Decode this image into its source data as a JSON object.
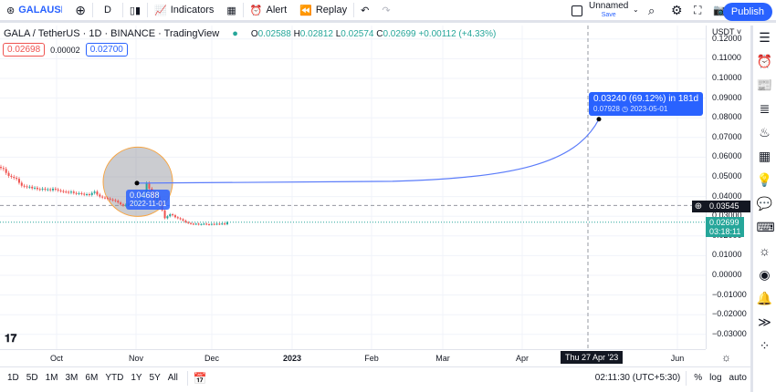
{
  "toolbar": {
    "symbol": "GALAUSDT",
    "interval": "D",
    "indicators": "Indicators",
    "alert": "Alert",
    "replay": "Replay",
    "layout_name": "Unnamed",
    "save": "Save",
    "publish": "Publish"
  },
  "legend": {
    "title": "GALA / TetherUS · 1D · BINANCE · TradingView",
    "o_label": "O",
    "o": "0.02588",
    "h_label": "H",
    "h": "0.02812",
    "l_label": "L",
    "l": "0.02574",
    "c_label": "C",
    "c": "0.02699",
    "change": "+0.00112 (+4.33%)",
    "bid": "0.02698",
    "spread": "0.00002",
    "ask": "0.02700"
  },
  "axis": {
    "currency": "USDT",
    "price_labels": [
      "0.12000",
      "0.11000",
      "0.10000",
      "0.09000",
      "0.08000",
      "0.07000",
      "0.06000",
      "0.05000",
      "0.04000",
      "0.03000",
      "0.02000",
      "0.01000",
      "0.00000",
      "−0.01000",
      "−0.02000",
      "−0.03000"
    ],
    "crosshair_price": "0.03545",
    "last_price": "0.02699",
    "countdown": "03:18:11"
  },
  "time_axis": {
    "labels": [
      "Oct",
      "Nov",
      "Dec",
      "2023",
      "Feb",
      "Mar",
      "Apr",
      "Jun"
    ],
    "crosshair_date": "Thu 27 Apr '23"
  },
  "projection": {
    "start_price": "0.04688",
    "start_date": "2022-11-01",
    "label": "0.03240 (69.12%) in 181d",
    "target": "0.07928",
    "target_date": "2023-05-01"
  },
  "bottom": {
    "ranges": [
      "1D",
      "5D",
      "1M",
      "3M",
      "6M",
      "YTD",
      "1Y",
      "5Y",
      "All"
    ],
    "clock": "02:11:30 (UTC+5:30)",
    "percent": "%",
    "log": "log",
    "auto": "auto"
  },
  "colors": {
    "up": "#26a69a",
    "down": "#ef5350",
    "accent": "#2962ff"
  },
  "chart_data": {
    "type": "candlestick",
    "start_date": "2022-09-05",
    "closes": [
      0.0545,
      0.054,
      0.052,
      0.0505,
      0.05,
      0.0495,
      0.049,
      0.047,
      0.0455,
      0.0452,
      0.0448,
      0.045,
      0.0442,
      0.0445,
      0.0438,
      0.0436,
      0.044,
      0.0435,
      0.0437,
      0.0432,
      0.044,
      0.0436,
      0.0431,
      0.0428,
      0.0425,
      0.0424,
      0.042,
      0.0425,
      0.0418,
      0.0415,
      0.0417,
      0.0414,
      0.041,
      0.0412,
      0.0408,
      0.0418,
      0.0425,
      0.041,
      0.04,
      0.0395,
      0.0393,
      0.039,
      0.0385,
      0.0382,
      0.0378,
      0.037,
      0.036,
      0.0355,
      0.0358,
      0.0362,
      0.036,
      0.0365,
      0.037,
      0.038,
      0.0395,
      0.042,
      0.0468,
      0.044,
      0.042,
      0.038,
      0.04,
      0.037,
      0.033,
      0.029,
      0.03,
      0.031,
      0.0305,
      0.0295,
      0.029,
      0.0285,
      0.0278,
      0.027,
      0.0265,
      0.0262,
      0.026,
      0.0262,
      0.0258,
      0.026,
      0.0262,
      0.0259,
      0.0258,
      0.0261,
      0.0259,
      0.0262,
      0.026,
      0.0263,
      0.0259,
      0.027
    ]
  }
}
